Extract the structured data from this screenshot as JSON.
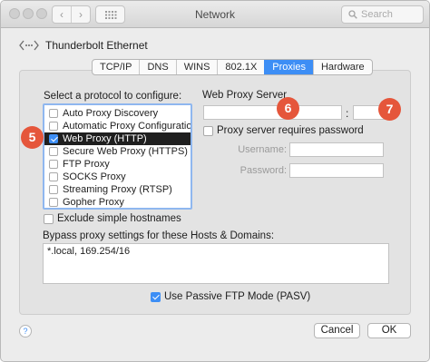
{
  "window": {
    "title": "Network",
    "search_placeholder": "Search"
  },
  "interface": {
    "name": "Thunderbolt Ethernet"
  },
  "tabs": [
    {
      "label": "TCP/IP",
      "active": false
    },
    {
      "label": "DNS",
      "active": false
    },
    {
      "label": "WINS",
      "active": false
    },
    {
      "label": "802.1X",
      "active": false
    },
    {
      "label": "Proxies",
      "active": true
    },
    {
      "label": "Hardware",
      "active": false
    }
  ],
  "protocols": {
    "label": "Select a protocol to configure:",
    "items": [
      {
        "label": "Auto Proxy Discovery",
        "checked": false,
        "selected": false
      },
      {
        "label": "Automatic Proxy Configuration",
        "checked": false,
        "selected": false
      },
      {
        "label": "Web Proxy (HTTP)",
        "checked": true,
        "selected": true
      },
      {
        "label": "Secure Web Proxy (HTTPS)",
        "checked": false,
        "selected": false
      },
      {
        "label": "FTP Proxy",
        "checked": false,
        "selected": false
      },
      {
        "label": "SOCKS Proxy",
        "checked": false,
        "selected": false
      },
      {
        "label": "Streaming Proxy (RTSP)",
        "checked": false,
        "selected": false
      },
      {
        "label": "Gopher Proxy",
        "checked": false,
        "selected": false
      }
    ]
  },
  "exclude_simple": {
    "label": "Exclude simple hostnames",
    "checked": false
  },
  "web_proxy": {
    "label": "Web Proxy Server",
    "server": "",
    "port": "",
    "colon": ":",
    "requires_password": {
      "label": "Proxy server requires password",
      "checked": false
    },
    "username_label": "Username:",
    "password_label": "Password:"
  },
  "badges": {
    "list": "5",
    "server": "6",
    "port": "7"
  },
  "bypass": {
    "label": "Bypass proxy settings for these Hosts & Domains:",
    "value": "*.local, 169.254/16"
  },
  "passive_ftp": {
    "label": "Use Passive FTP Mode (PASV)",
    "checked": true
  },
  "footer": {
    "help": "?",
    "cancel": "Cancel",
    "ok": "OK"
  },
  "colors": {
    "accent": "#3d8ef5",
    "badge": "#e5563b",
    "selection": "#1f1f1f"
  }
}
